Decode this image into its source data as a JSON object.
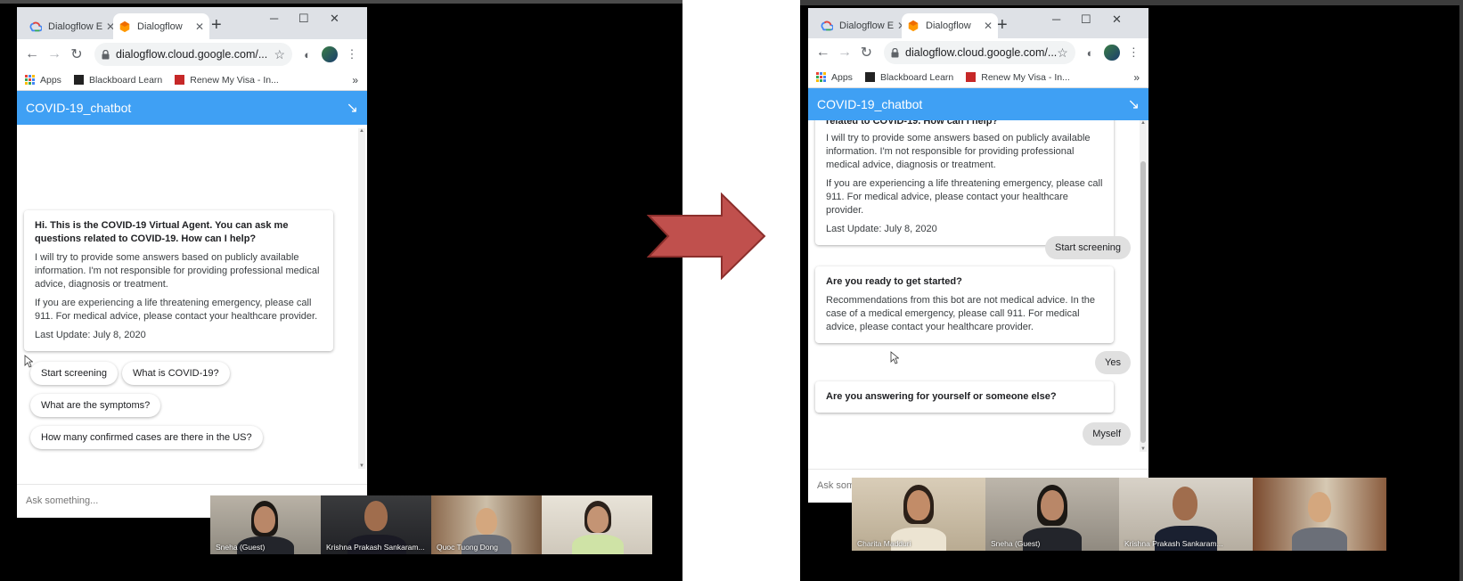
{
  "colors": {
    "chat_header": "#3fa0f4",
    "arrow": "#c0504d",
    "arrow_edge": "#8c2f2c"
  },
  "left": {
    "tabs": [
      {
        "title": "Dialogflow E",
        "icon": "google-cloud-icon",
        "active": false
      },
      {
        "title": "Dialogflow",
        "icon": "dialogflow-icon",
        "active": true
      }
    ],
    "url": "dialogflow.cloud.google.com/...",
    "bookmarks": [
      "Apps",
      "Blackboard Learn",
      "Renew My Visa - In..."
    ],
    "bookmarks_more": "»",
    "chat_title": "COVID-19_chatbot",
    "intro": {
      "heading": "Hi. This is the COVID-19 Virtual Agent. You can ask me questions related to COVID-19. How can I help?",
      "p1": "I will try to provide some answers based on publicly available information. I'm not responsible for providing professional medical advice, diagnosis or treatment.",
      "p2": "If you are experiencing a life threatening emergency, please call 911. For medical advice, please contact your healthcare provider.",
      "p3": "Last Update: July 8, 2020"
    },
    "chips": [
      "Start screening",
      "What is COVID-19?",
      "What are the symptoms?",
      "How many confirmed cases are there in the US?"
    ],
    "input_placeholder": "Ask something...",
    "participants": [
      "Sneha (Guest)",
      "Krishna Prakash Sankaram...",
      "Quoc Tuong Dong",
      ""
    ]
  },
  "right": {
    "tabs": [
      {
        "title": "Dialogflow E",
        "icon": "google-cloud-icon",
        "active": false
      },
      {
        "title": "Dialogflow",
        "icon": "dialogflow-icon",
        "active": true
      }
    ],
    "url": "dialogflow.cloud.google.com/...",
    "bookmarks": [
      "Apps",
      "Blackboard Learn",
      "Renew My Visa - In..."
    ],
    "bookmarks_more": "»",
    "chat_title": "COVID-19_chatbot",
    "intro": {
      "heading_fragment": "related to COVID-19. How can I help?",
      "p1": "I will try to provide some answers based on publicly available information. I'm not responsible for providing professional medical advice, diagnosis or treatment.",
      "p2": "If you are experiencing a life threatening emergency, please call 911. For medical advice, please contact your healthcare provider.",
      "p3": "Last Update: July 8, 2020"
    },
    "user_reply_1": "Start screening",
    "bot_q1": {
      "heading": "Are you ready to get started?",
      "body": "Recommendations from this bot are not medical advice. In the case of a medical emergency, please call 911. For medical advice, please contact your healthcare provider."
    },
    "user_reply_2": "Yes",
    "bot_q2": {
      "heading": "Are you answering for yourself or someone else?"
    },
    "user_reply_3": "Myself",
    "input_placeholder": "Ask something...",
    "participants": [
      "Charita Madduri",
      "Sneha (Guest)",
      "Krishna Prakash Sankaram...",
      ""
    ]
  },
  "window_controls": {
    "minimize": "─",
    "maximize": "☐",
    "close": "✕"
  },
  "tab_close": "✕",
  "new_tab": "+"
}
